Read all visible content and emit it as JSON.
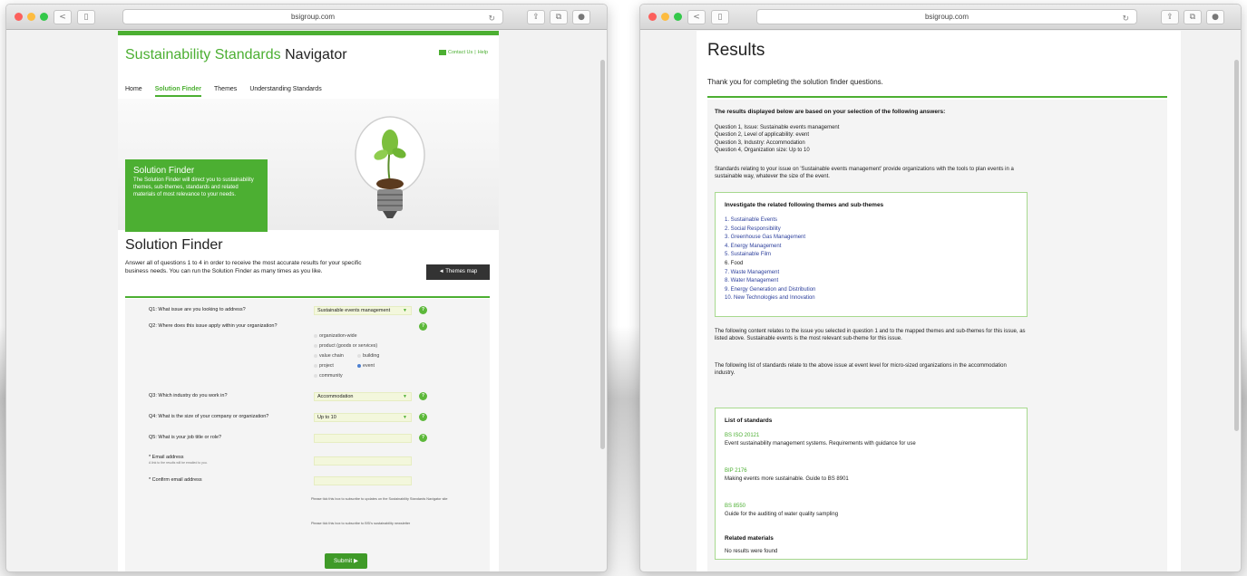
{
  "browser": {
    "left_url": "bsigroup.com",
    "right_url": "bsigroup.com",
    "light_colors": [
      "#fc605c",
      "#fdbc40",
      "#34c84a"
    ],
    "icons": [
      "back-icon",
      "sidebar-icon",
      "reload-icon",
      "share-icon",
      "tabs-icon",
      "extension-icon"
    ]
  },
  "left": {
    "site_title_green": "Sustainability Standards",
    "site_title_dark": "Navigator",
    "header_links": {
      "contact": "Contact Us",
      "separator": "|",
      "help": "Help"
    },
    "nav": [
      "Home",
      "Solution Finder",
      "Themes",
      "Understanding Standards"
    ],
    "hero": {
      "title": "Solution Finder",
      "text": "The Solution Finder will direct you to sustainability themes, sub-themes, standards and related materials of most relevance to your needs."
    },
    "page_title": "Solution Finder",
    "intro": "Answer all of questions 1 to 4 in order to receive the most accurate results for your specific business needs. You can run the Solution Finder as many times as you like.",
    "themes_map_button": "◄ Themes map",
    "form": {
      "q1": "Q1: What issue are you looking to address?",
      "q1_value": "Sustainable events management",
      "q2": "Q2: Where does this issue apply within your organization?",
      "q2_options": [
        "organization-wide",
        "product (goods or services)",
        "value chain",
        "building",
        "project",
        "event",
        "community"
      ],
      "q2_selected": "event",
      "q3": "Q3: Which industry do you work in?",
      "q3_value": "Accommodation",
      "q4": "Q4: What is the size of your company or organization?",
      "q4_value": "Up to 10",
      "q5": "Q5: What is your job title or role?",
      "email_label": "* Email address",
      "email_hint": "A link to the results will be emailed to you.",
      "confirm_email_label": "* Confirm email address",
      "note1": "Please tick this box to subscribe to updates on the Sustainability Standards Navigator site",
      "note2": "Please tick this box to subscribe to BSI's sustainability newsletter",
      "help_glyph": "?",
      "dropdown_glyph": "▼",
      "submit": "Submit ▶"
    }
  },
  "right": {
    "title": "Results",
    "thanks": "Thank you for completing the solution finder questions.",
    "based_on": "The results displayed below are based on your selection of the following answers:",
    "answers": [
      "Question 1, Issue: Sustainable events management",
      "Question 2, Level of applicability: event",
      "Question 3, Industry: Accommodation",
      "Question 4, Organization size: Up to 10"
    ],
    "standards_intro": "Standards relating to your issue on 'Sustainable events management' provide organizations with the tools to plan events in a sustainable way, whatever the size of the event.",
    "themes_title": "Investigate the related following themes and sub-themes",
    "themes": [
      "1. Sustainable Events",
      "2. Social Responsibility",
      "3. Greenhouse Gas Management",
      "4. Energy Management",
      "5. Sustainable Film",
      "6. Food",
      "7. Waste Management",
      "8. Water Management",
      "9. Energy Generation and Distribution",
      "10. New Technologies and Innovation"
    ],
    "content_note": "The following content relates to the issue you selected in question 1 and to the mapped themes and sub-themes for this issue, as listed above. Sustainable events is the most relevant sub-theme for this issue.",
    "list_note": "The following list of standards relate to the above issue at event level for micro-sized organizations in the accommodation industry.",
    "list_title": "List of standards",
    "standards": [
      {
        "code": "BS ISO 20121",
        "desc": "Event sustainability management systems. Requirements with guidance for use"
      },
      {
        "code": "BIP 2176",
        "desc": "Making events more sustainable. Guide to BS 8901"
      },
      {
        "code": "BS 8550",
        "desc": "Guide for the auditing of water quality sampling"
      }
    ],
    "related_title": "Related materials",
    "related_text": "No results were found"
  },
  "colors": {
    "brand_green": "#4caf32",
    "dark_button": "#333333",
    "link_blue": "#2c3f9c"
  }
}
